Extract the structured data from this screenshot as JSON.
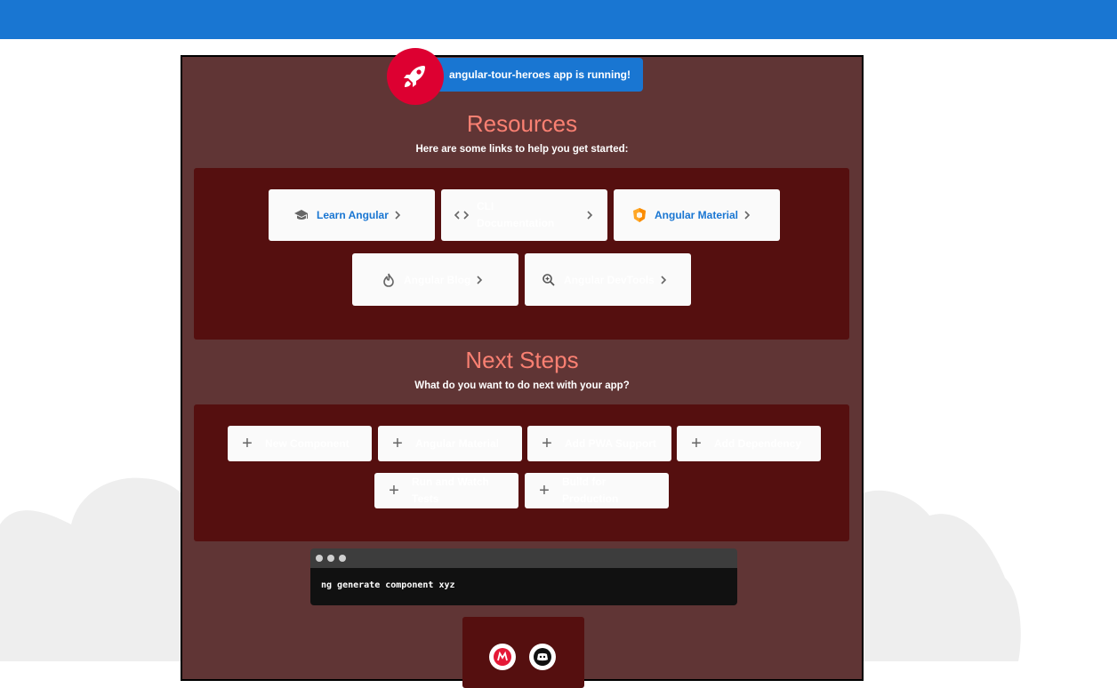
{
  "app_status": "angular-tour-heroes app is running!",
  "resources": {
    "title": "Resources",
    "subtitle": "Here are some links to help you get started:",
    "cards": [
      {
        "label": "Learn Angular",
        "icon": "graduation-cap-icon"
      },
      {
        "label": "CLI Documentation",
        "icon": "code-icon"
      },
      {
        "label": "Angular Material",
        "icon": "angular-material-icon"
      },
      {
        "label": "Angular Blog",
        "icon": "flame-icon"
      },
      {
        "label": "Angular DevTools",
        "icon": "devtools-icon"
      }
    ]
  },
  "next_steps": {
    "title": "Next Steps",
    "subtitle": "What do you want to do next with your app?",
    "actions": [
      {
        "label": "New Component"
      },
      {
        "label": "Angular Material"
      },
      {
        "label": "Add PWA Support"
      },
      {
        "label": "Add Dependency"
      },
      {
        "label": "Run and Watch Tests"
      },
      {
        "label": "Build for Production"
      }
    ]
  },
  "terminal": {
    "command": "ng generate component xyz"
  },
  "colors": {
    "topbar": "#1976d2",
    "panel": "#603535",
    "dark_box": "#550f0f",
    "title": "#fa8072",
    "rocket": "#dd0031"
  }
}
